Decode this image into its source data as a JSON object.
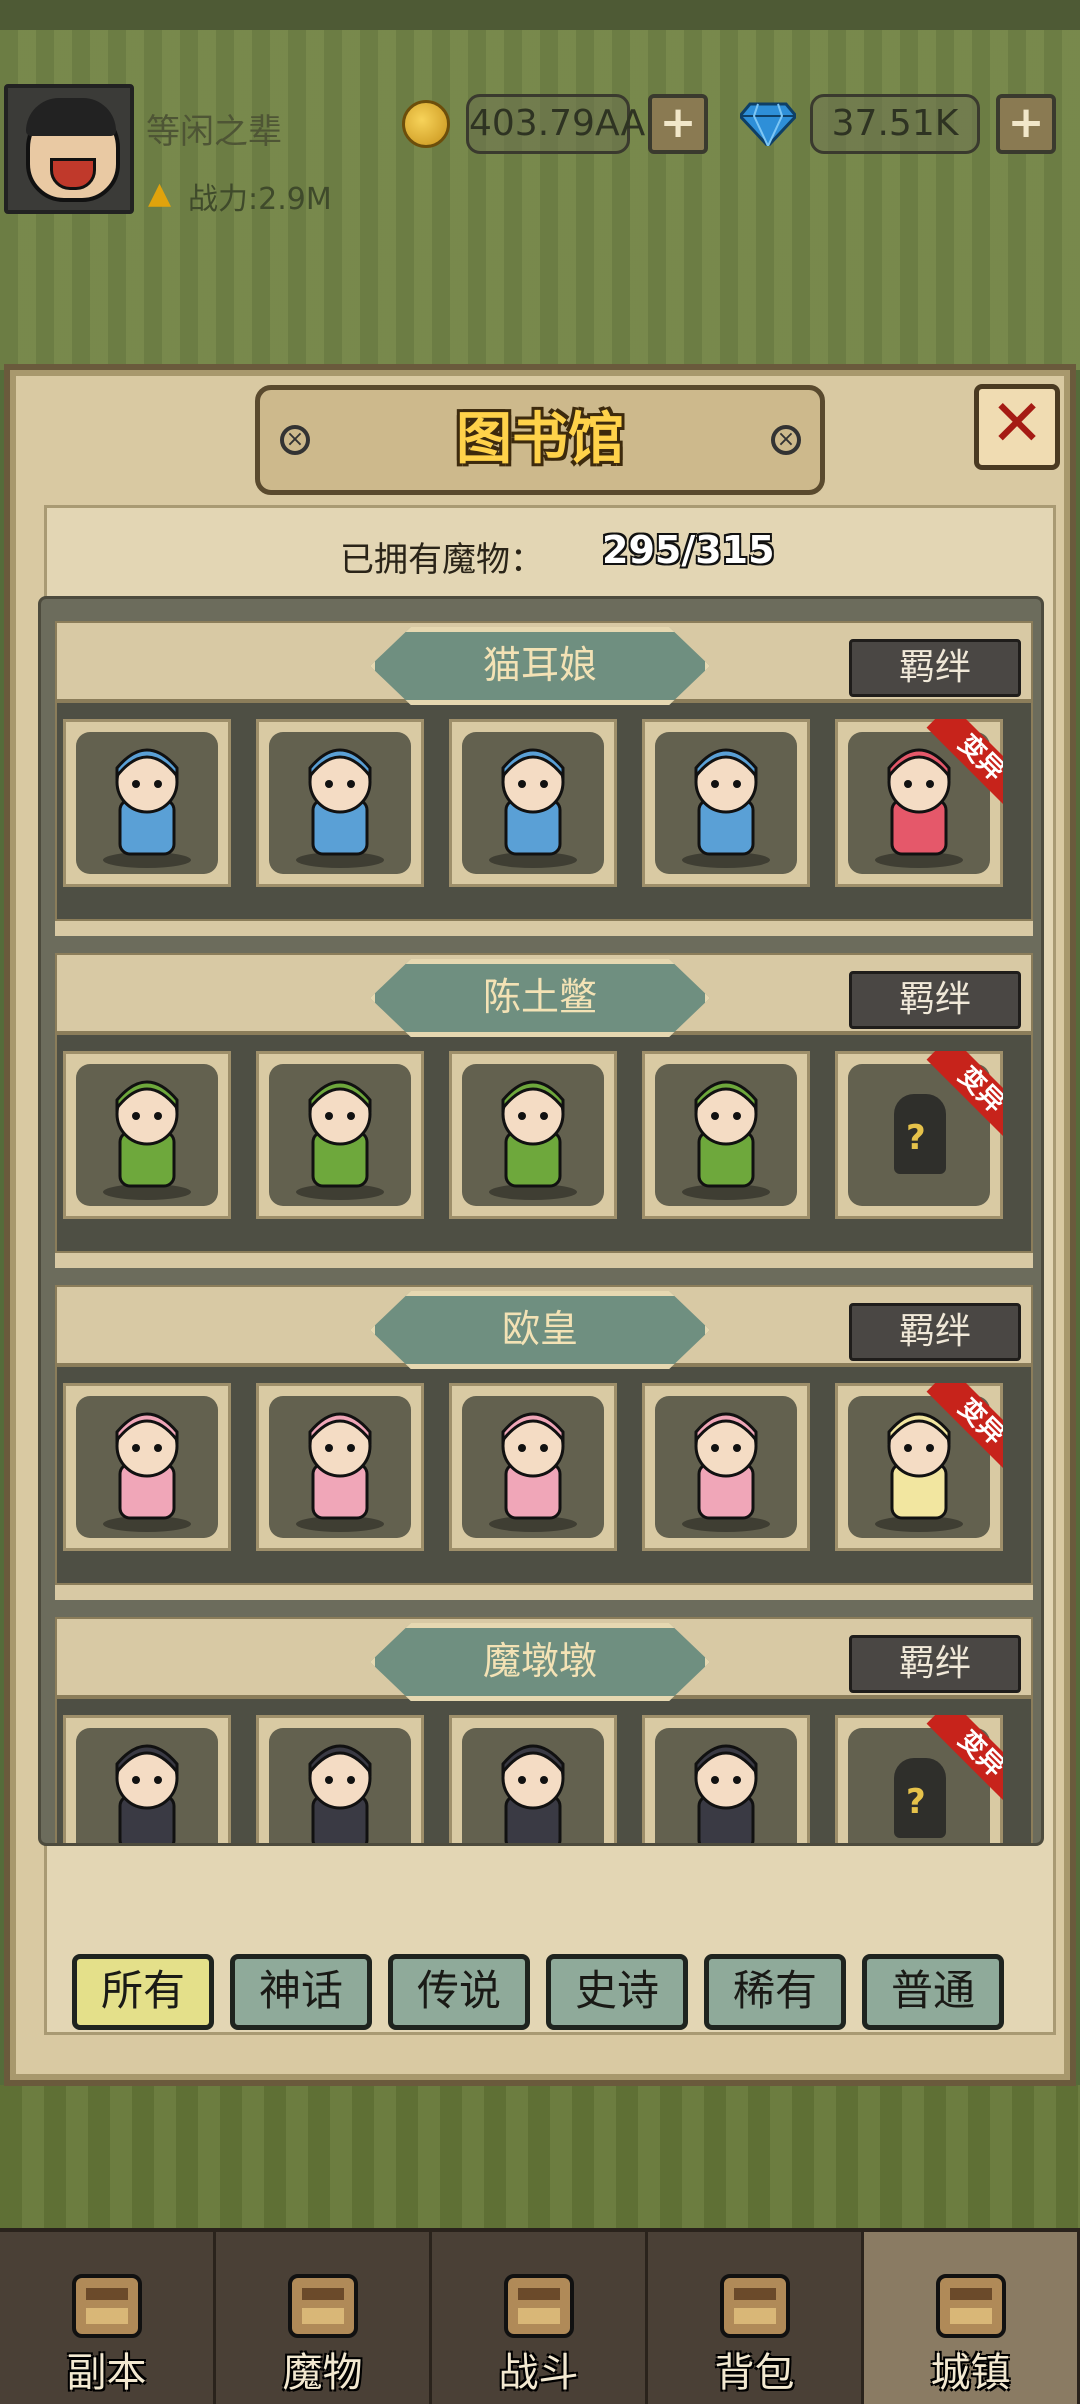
{
  "header": {
    "player_name": "等闲之辈",
    "power": "战力:2.9M",
    "gold": "403.79AA",
    "gems": "37.51K",
    "plus": "+"
  },
  "library": {
    "title": "图书馆",
    "close": "✕",
    "owned_label": "已拥有魔物：",
    "owned_value": "295/315",
    "bond_label": "羁绊",
    "variant_label": "变异",
    "unknown_mark": "?",
    "groups": [
      {
        "name": "猫耳娘",
        "color": "#5aa0d6",
        "variant_color": "#e5586a",
        "variant_unlocked": true
      },
      {
        "name": "陈土鳖",
        "color": "#6ea83c",
        "variant_color": "#6ea83c",
        "variant_unlocked": false
      },
      {
        "name": "欧皇",
        "color": "#f0a6b8",
        "variant_color": "#f2e6a0",
        "variant_unlocked": true
      },
      {
        "name": "魔墩墩",
        "color": "#3a3a44",
        "variant_color": "#3a3a44",
        "variant_unlocked": false
      }
    ]
  },
  "filters": [
    "所有",
    "神话",
    "传说",
    "史诗",
    "稀有",
    "普通"
  ],
  "filter_active": "所有",
  "nav": [
    {
      "label": "副本",
      "icon": "map-icon"
    },
    {
      "label": "魔物",
      "icon": "monster-icon"
    },
    {
      "label": "战斗",
      "icon": "swords-icon"
    },
    {
      "label": "背包",
      "icon": "backpack-icon"
    },
    {
      "label": "城镇",
      "icon": "town-icon"
    }
  ],
  "nav_active": "城镇",
  "colors": {
    "title_text": "#ffd24a",
    "close_x": "#a51b14",
    "ribbon": "#c7231b",
    "active_filter": "#e4e08a"
  }
}
